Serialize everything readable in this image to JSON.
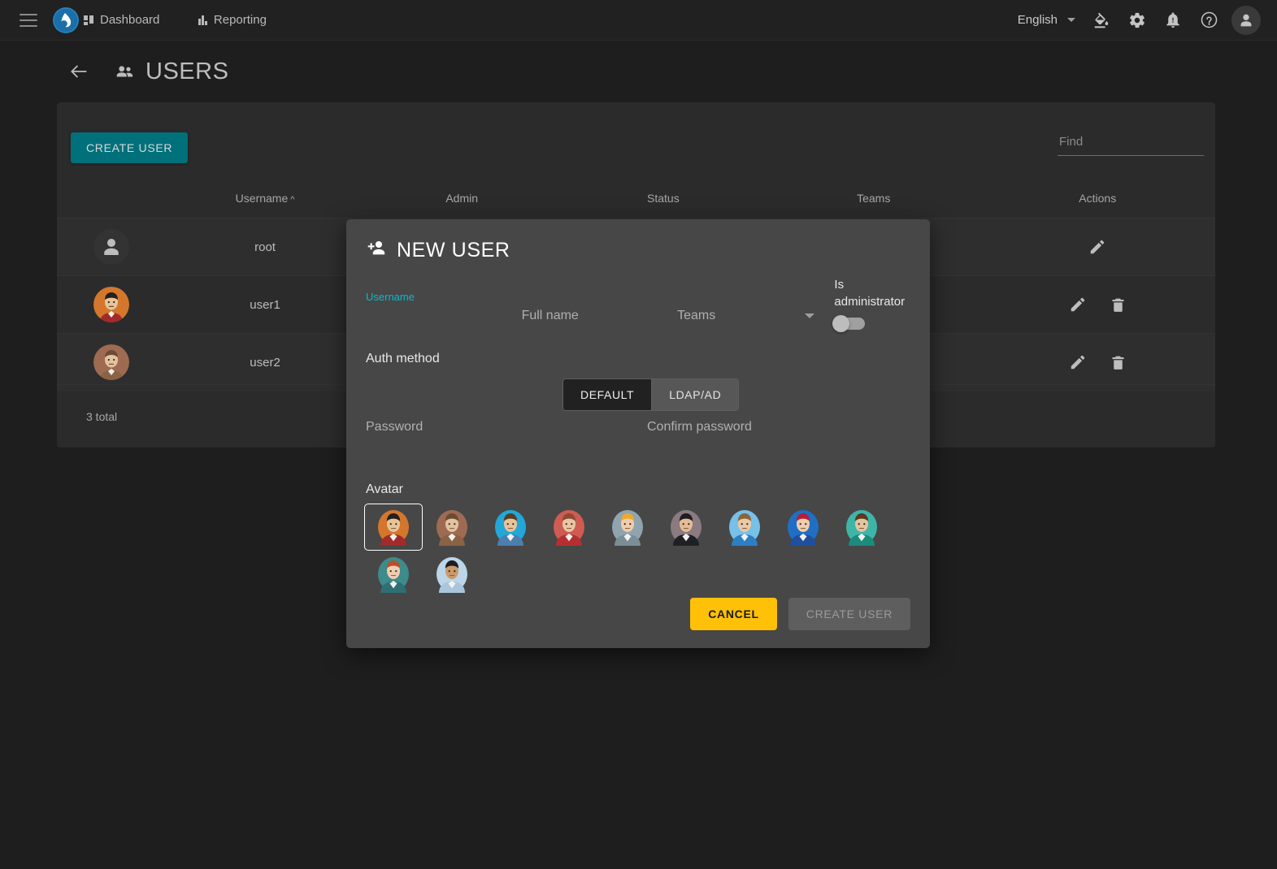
{
  "topbar": {
    "menu_icon": "hamburger-icon",
    "logo_icon": "app-logo",
    "nav": [
      {
        "label": "Dashboard",
        "icon": "dashboard-icon"
      },
      {
        "label": "Reporting",
        "icon": "bar-chart-icon"
      }
    ],
    "language": "English",
    "icons": [
      {
        "name": "theme-paint-icon"
      },
      {
        "name": "settings-gear-icon"
      },
      {
        "name": "notifications-bell-icon"
      },
      {
        "name": "help-circle-icon"
      },
      {
        "name": "user-account-icon"
      }
    ]
  },
  "page": {
    "back_icon": "back-arrow-icon",
    "title_icon": "users-group-icon",
    "title": "USERS"
  },
  "toolbar": {
    "create_user_label": "CREATE USER",
    "find_placeholder": "Find",
    "find_value": ""
  },
  "table": {
    "columns": [
      "",
      "Username",
      "Admin",
      "Status",
      "Teams",
      "Actions"
    ],
    "sort_column": "Username",
    "sort_caret": "^",
    "rows": [
      {
        "avatar": "default-person",
        "username": "root",
        "admin": "",
        "status": "",
        "teams": "",
        "can_delete": false
      },
      {
        "avatar": "avatar-1",
        "username": "user1",
        "admin": "",
        "status": "",
        "teams": "",
        "can_delete": true
      },
      {
        "avatar": "avatar-2",
        "username": "user2",
        "admin": "",
        "status": "",
        "teams": "",
        "can_delete": true
      }
    ],
    "total_text": "3 total"
  },
  "modal": {
    "title": "NEW USER",
    "title_icon": "person-add-icon",
    "fields": {
      "username_label": "Username",
      "username_value": "",
      "fullname_placeholder": "Full name",
      "fullname_value": "",
      "teams_placeholder": "Teams",
      "teams_value": "",
      "is_admin_label": "Is administrator",
      "is_admin_on": false
    },
    "auth": {
      "label": "Auth method",
      "options": [
        "DEFAULT",
        "LDAP/AD"
      ],
      "selected": "DEFAULT"
    },
    "password": {
      "password_placeholder": "Password",
      "password_value": "",
      "confirm_placeholder": "Confirm password",
      "confirm_value": ""
    },
    "avatar": {
      "label": "Avatar",
      "selected_index": 0,
      "items": [
        {
          "name": "avatar-1",
          "bg": "#d4772c",
          "hair": "#23201d",
          "skin": "#e8c49a",
          "body": "#a32a2a"
        },
        {
          "name": "avatar-2",
          "bg": "#9e6b52",
          "hair": "#6d4b33",
          "skin": "#e3c2a0",
          "body": "#8a6244"
        },
        {
          "name": "avatar-3",
          "bg": "#22a7d8",
          "hair": "#5a3c26",
          "skin": "#e8c49a",
          "body": "#4a7fae"
        },
        {
          "name": "avatar-4",
          "bg": "#cf5c52",
          "hair": "#8e4a35",
          "skin": "#eac6a4",
          "body": "#b52f31"
        },
        {
          "name": "avatar-5",
          "bg": "#8fa4ae",
          "hair": "#f0a830",
          "skin": "#f0cdae",
          "body": "#7b8e97"
        },
        {
          "name": "avatar-6",
          "bg": "#8b7a80",
          "hair": "#1d1d22",
          "skin": "#e3bc97",
          "body": "#1f1f26"
        },
        {
          "name": "avatar-7",
          "bg": "#77c0e8",
          "hair": "#8b6437",
          "skin": "#eac9a6",
          "body": "#2c7fc4"
        },
        {
          "name": "avatar-8",
          "bg": "#1f6fc4",
          "hair": "#b51e35",
          "skin": "#f0cdae",
          "body": "#1f4f9e"
        },
        {
          "name": "avatar-9",
          "bg": "#3fb5a8",
          "hair": "#5a3a22",
          "skin": "#e5c49e",
          "body": "#1b8c7c"
        },
        {
          "name": "avatar-10",
          "bg": "#3d8b8b",
          "hair": "#b5512a",
          "skin": "#f0cdae",
          "body": "#2e6f73"
        },
        {
          "name": "avatar-11",
          "bg": "#bcd6e8",
          "hair": "#1d1d22",
          "skin": "#c99a6b",
          "body": "#a9c6dd"
        }
      ]
    },
    "actions": {
      "cancel_label": "CANCEL",
      "submit_label": "CREATE USER",
      "submit_disabled": true
    }
  },
  "colors": {
    "accent_teal": "#00707a",
    "active_field": "#00bcd4",
    "cancel_yellow": "#ffc107",
    "logo_blue": "#1a6fa8"
  }
}
